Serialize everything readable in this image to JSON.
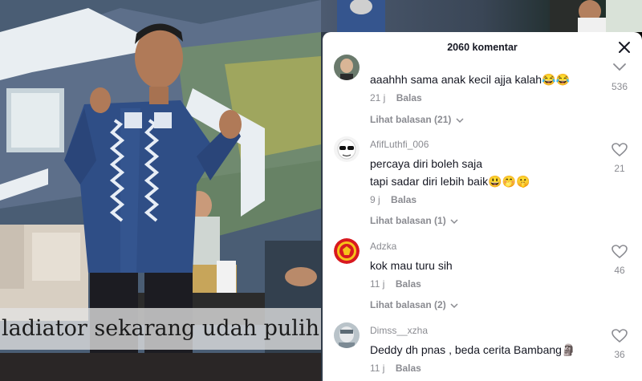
{
  "video": {
    "caption": "ladiator sekarang udah pulih"
  },
  "comments_panel": {
    "title": "2060 komentar",
    "close_icon": "close-icon",
    "comments": [
      {
        "username": "",
        "text": "aaahhh sama anak kecil ajja kalah😂😂",
        "time": "21 j",
        "reply_label": "Balas",
        "likes": "536",
        "replies_label": "Lihat balasan (21)"
      },
      {
        "username": "AfifLuthfi_006",
        "text_line1": "percaya diri boleh saja",
        "text_line2": "tapi sadar diri lebih baik😃🤭🤫",
        "time": "9 j",
        "reply_label": "Balas",
        "likes": "21",
        "replies_label": "Lihat balasan (1)"
      },
      {
        "username": "Adzka",
        "text": "kok mau turu sih",
        "time": "11 j",
        "reply_label": "Balas",
        "likes": "46",
        "replies_label": "Lihat balasan (2)"
      },
      {
        "username": "Dimss__xzha",
        "text": "Deddy dh pnas , beda cerita Bambang🗿",
        "time": "11 j",
        "reply_label": "Balas",
        "likes": "36"
      }
    ]
  },
  "colors": {
    "panel_bg": "#ffffff",
    "primary_text": "#161823",
    "secondary_text": "#8a8b91",
    "caption_bg": "#e1e1e1"
  }
}
